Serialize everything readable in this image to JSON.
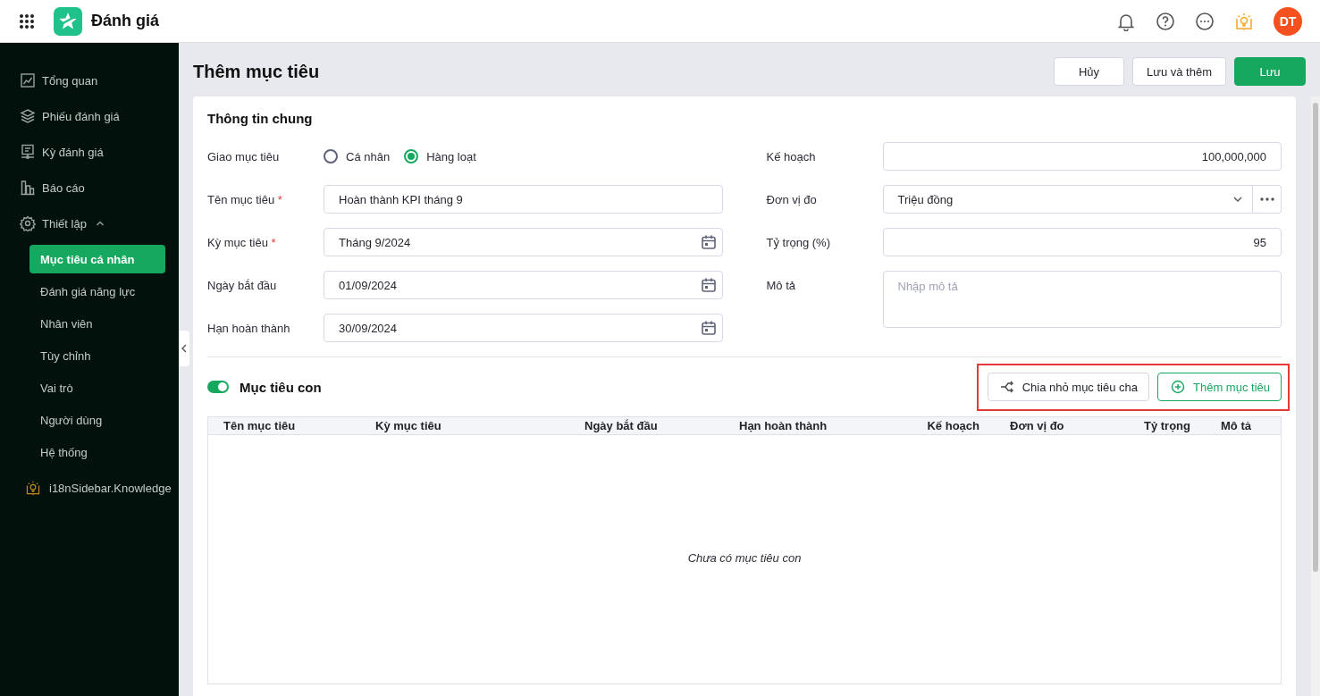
{
  "app": {
    "title": "Đánh giá",
    "avatar_initials": "DT"
  },
  "sidebar": {
    "items": [
      {
        "label": "Tổng quan",
        "selected": false
      },
      {
        "label": "Phiếu đánh giá",
        "selected": false
      },
      {
        "label": "Kỳ đánh giá",
        "selected": false
      },
      {
        "label": "Báo cáo",
        "selected": false
      },
      {
        "label": "Thiết lập",
        "selected": false,
        "expanded": true,
        "children": [
          {
            "label": "Mục tiêu cá nhân",
            "selected": true
          },
          {
            "label": "Đánh giá năng lực",
            "selected": false
          },
          {
            "label": "Nhân viên",
            "selected": false
          },
          {
            "label": "Tùy chỉnh",
            "selected": false
          },
          {
            "label": "Vai trò",
            "selected": false
          },
          {
            "label": "Người dùng",
            "selected": false
          },
          {
            "label": "Hệ thống",
            "selected": false
          }
        ]
      },
      {
        "label": "i18nSidebar.Knowledge",
        "selected": false
      }
    ]
  },
  "page": {
    "title": "Thêm mục tiêu",
    "actions": [
      {
        "label": "Hủy",
        "kind": "default"
      },
      {
        "label": "Lưu và thêm",
        "kind": "default"
      },
      {
        "label": "Lưu",
        "kind": "primary"
      }
    ]
  },
  "general": {
    "title": "Thông tin chung",
    "assign": {
      "label": "Giao mục tiêu",
      "options": [
        {
          "label": "Cá nhân",
          "selected": false
        },
        {
          "label": "Hàng loạt",
          "selected": true
        }
      ]
    },
    "left_fields": [
      {
        "label": "Tên mục tiêu",
        "required_mark": "*",
        "kind": "text",
        "value": "Hoàn thành KPI tháng 9"
      },
      {
        "label": "Kỳ mục tiêu",
        "required_mark": "*",
        "kind": "date",
        "value": "Tháng 9/2024"
      },
      {
        "label": "Ngày bắt đầu",
        "kind": "date",
        "value": "01/09/2024"
      },
      {
        "label": "Hạn hoàn thành",
        "kind": "date",
        "value": "30/09/2024"
      }
    ],
    "right_fields": [
      {
        "label": "Kế hoạch",
        "kind": "number",
        "value": "100,000,000"
      },
      {
        "label": "Đơn vị đo",
        "kind": "select",
        "value": "Triệu đồng"
      },
      {
        "label": "Tỷ trọng (%)",
        "kind": "number",
        "value": "95"
      },
      {
        "label": "Mô tả",
        "kind": "textarea",
        "placeholder": "Nhập mô tả"
      }
    ]
  },
  "subgoals": {
    "title": "Mục tiêu con",
    "on": true,
    "highlighted": true,
    "actions": [
      {
        "label": "Chia nhỏ mục tiêu cha",
        "kind": "split"
      },
      {
        "label": "Thêm mục tiêu",
        "kind": "add"
      }
    ],
    "table": {
      "columns": [
        {
          "label": "Tên mục tiêu"
        },
        {
          "label": "Kỳ mục tiêu"
        },
        {
          "label": "Ngày bắt đầu"
        },
        {
          "label": "Hạn hoàn thành"
        },
        {
          "label": "Kế hoạch"
        },
        {
          "label": "Đơn vị đo"
        },
        {
          "label": "Tỷ trọng"
        },
        {
          "label": "Mô tả"
        }
      ],
      "empty_text": "Chưa có mục tiêu con"
    }
  }
}
